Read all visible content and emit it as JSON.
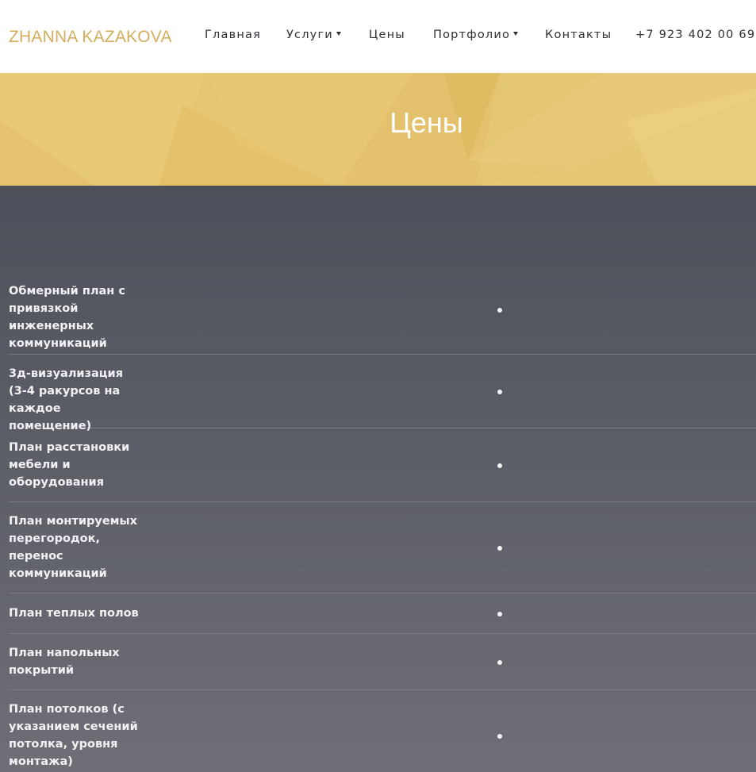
{
  "header": {
    "logo": "ZHANNA KAZAKOVA",
    "nav": [
      {
        "label": "Главная",
        "dropdown": false
      },
      {
        "label": "Услуги",
        "dropdown": true
      },
      {
        "label": "Цены",
        "dropdown": false
      },
      {
        "label": "Портфолио",
        "dropdown": true
      },
      {
        "label": "Контакты",
        "dropdown": false
      }
    ],
    "phone": "+7 923 402 00 69"
  },
  "banner": {
    "title": "Цены"
  },
  "prices": {
    "rows": [
      {
        "label": "Обмерный план с привязкой инженерных коммуникаций",
        "value_icon": "bullet"
      },
      {
        "label": "3д-визуализация (3-4 ракурсов на каждое помещение)",
        "value_icon": "bullet"
      },
      {
        "label": "План расстановки мебели и оборудования",
        "value_icon": "bullet"
      },
      {
        "label": "План монтируемых перегородок, перенос коммуникаций",
        "value_icon": "bullet"
      },
      {
        "label": "План теплых полов",
        "value_icon": "bullet"
      },
      {
        "label": "План напольных покрытий",
        "value_icon": "bullet"
      },
      {
        "label": "План потолков (с указанием сечений потолка, уровня монтажа)",
        "value_icon": "bullet"
      }
    ]
  },
  "colors": {
    "brand_gold": "#d4ae5c",
    "banner": "#e5c673",
    "content_bg": "#4d4f5a",
    "nav_text": "#2f2f35"
  }
}
